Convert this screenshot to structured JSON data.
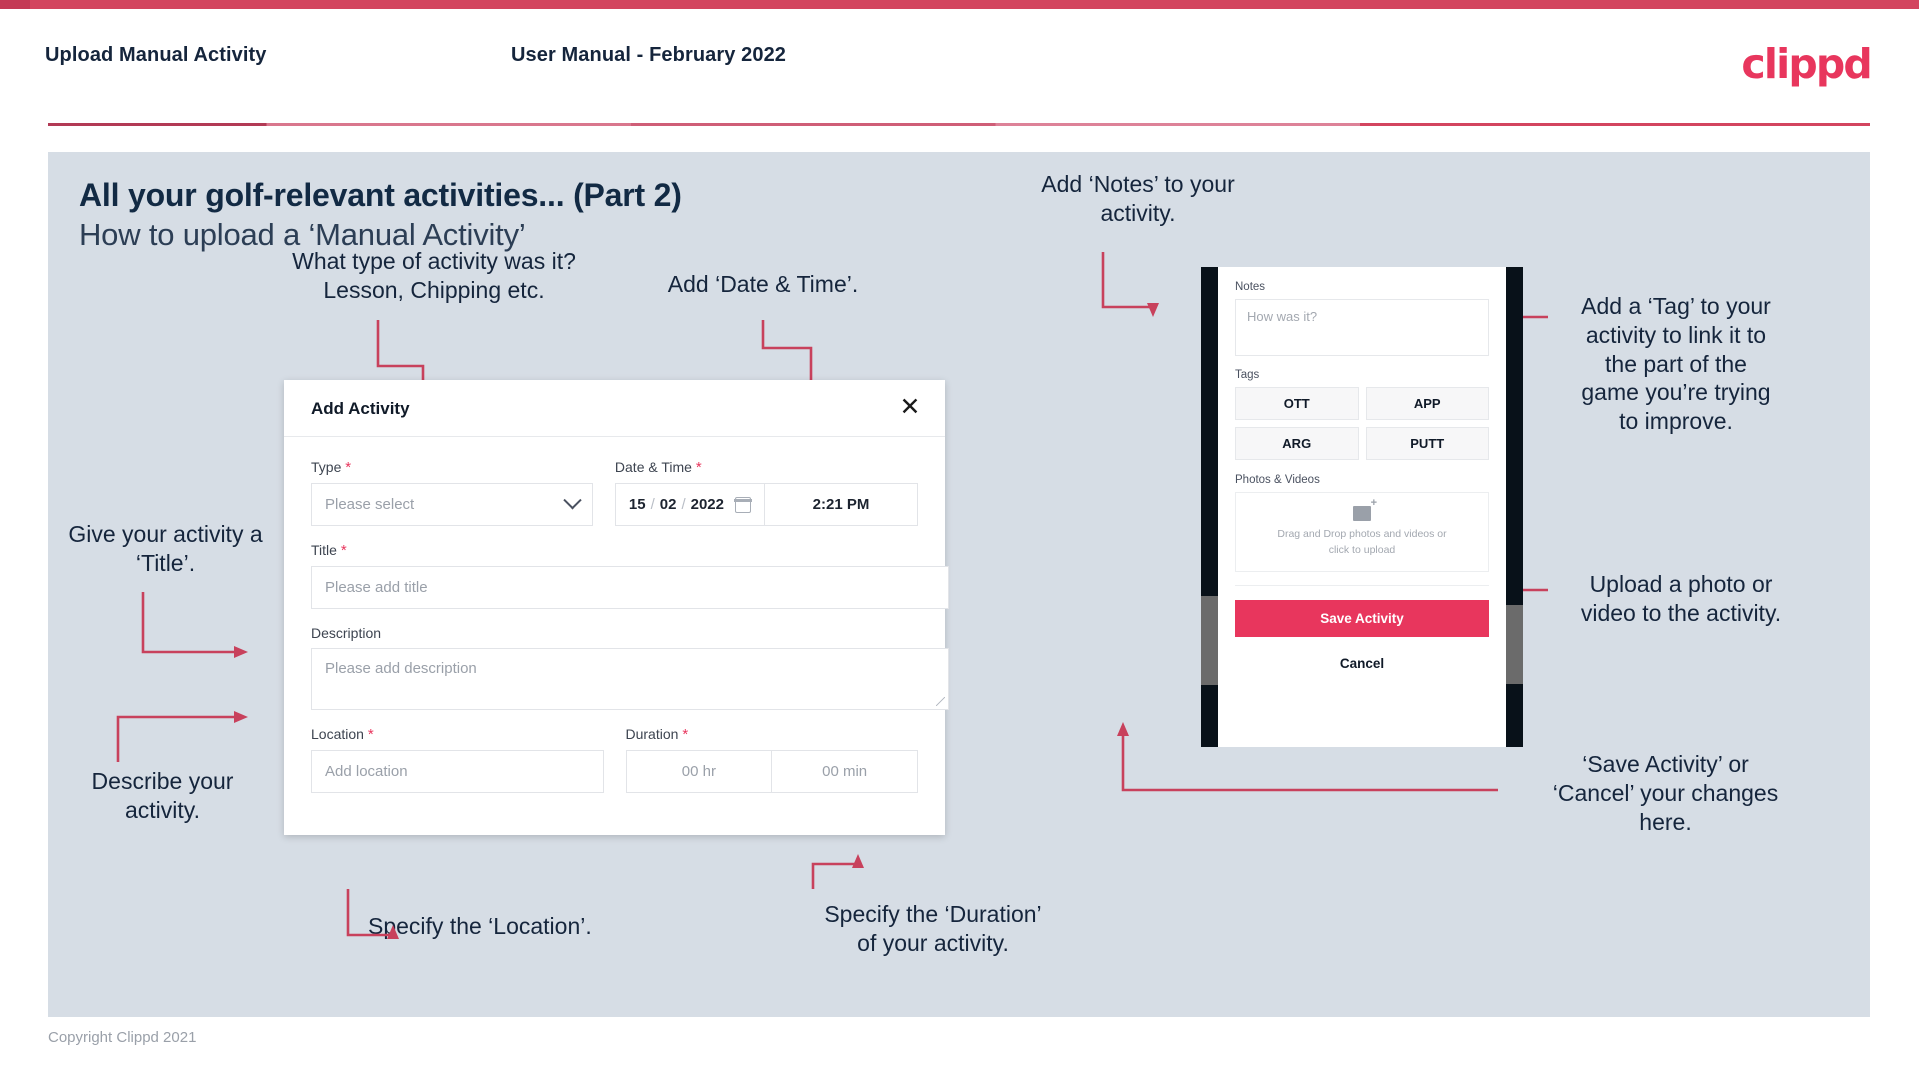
{
  "header": {
    "title": "Upload Manual Activity",
    "subtitle": "User Manual - February 2022",
    "logo": "clippd"
  },
  "slide": {
    "title": "All your golf-relevant activities... (Part 2)",
    "subtitle": "How to upload a ‘Manual Activity’"
  },
  "annotations": {
    "type": "What type of activity was it?\nLesson, Chipping etc.",
    "datetime": "Add ‘Date & Time’.",
    "title": "Give your activity a\n‘Title’.",
    "description": "Describe your\nactivity.",
    "location": "Specify the ‘Location’.",
    "duration": "Specify the ‘Duration’\nof your activity.",
    "notes": "Add ‘Notes’ to your\nactivity.",
    "tags": "Add a ‘Tag’ to your\nactivity to link it to\nthe part of the\ngame you’re trying\nto improve.",
    "photos": "Upload a photo or\nvideo to the activity.",
    "save": "‘Save Activity’ or\n‘Cancel’ your changes\nhere."
  },
  "dialog": {
    "title": "Add Activity",
    "close_icon": "close-icon",
    "fields": {
      "type_label": "Type",
      "type_value": "Please select",
      "datetime_label": "Date & Time",
      "date_day": "15",
      "date_month": "02",
      "date_year": "2022",
      "date_sep": "/",
      "time_value": "2:21 PM",
      "title_label": "Title",
      "title_placeholder": "Please add title",
      "description_label": "Description",
      "description_placeholder": "Please add description",
      "location_label": "Location",
      "location_placeholder": "Add location",
      "duration_label": "Duration",
      "duration_hours": "00 hr",
      "duration_minutes": "00 min"
    },
    "required_marker": "*"
  },
  "phone": {
    "notes_label": "Notes",
    "notes_placeholder": "How was it?",
    "tags_label": "Tags",
    "tags": [
      "OTT",
      "APP",
      "ARG",
      "PUTT"
    ],
    "photos_label": "Photos & Videos",
    "drop_text": "Drag and Drop photos and videos or\nclick to upload",
    "save_label": "Save Activity",
    "cancel_label": "Cancel"
  },
  "footer": {
    "copyright": "Copyright Clippd 2021"
  },
  "colors": {
    "accent": "#e8365d",
    "accent_bar": "#d3455f",
    "slide_bg": "#d6dde5",
    "text_dark": "#15253c",
    "connector": "#c8415c"
  }
}
